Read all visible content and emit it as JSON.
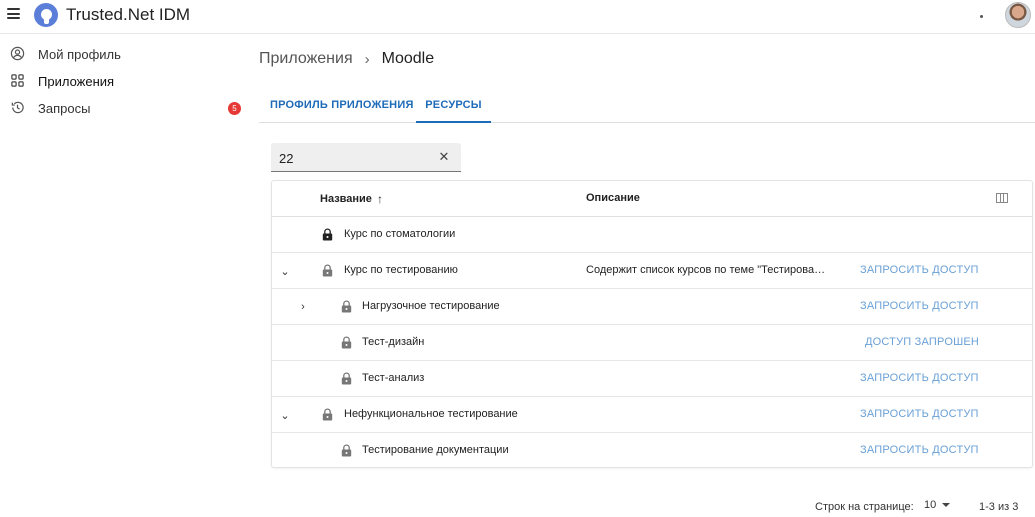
{
  "app": {
    "title": "Trusted.Net IDM"
  },
  "sidebar": {
    "items": [
      {
        "label": "Мой профиль",
        "icon": "account-circle-icon"
      },
      {
        "label": "Приложения",
        "icon": "apps-grid-icon"
      },
      {
        "label": "Запросы",
        "icon": "history-icon",
        "badge": "5"
      }
    ]
  },
  "breadcrumb": {
    "parent": "Приложения",
    "separator": "›",
    "current": "Moodle"
  },
  "tabs": [
    {
      "label": "ПРОФИЛЬ ПРИЛОЖЕНИЯ"
    },
    {
      "label": "РЕСУРСЫ"
    }
  ],
  "search": {
    "value": "22",
    "clear": "✕"
  },
  "table": {
    "headers": {
      "name": "Название",
      "sort": "↑",
      "description": "Описание"
    },
    "rows": [
      {
        "name": "Курс по стоматологии",
        "description": "",
        "action": ""
      },
      {
        "name": "Курс по тестированию",
        "description": "Содержит список курсов по теме \"Тестирование\"",
        "action": "ЗАПРОСИТЬ ДОСТУП"
      },
      {
        "name": "Нагрузочное тестирование",
        "description": "",
        "action": "ЗАПРОСИТЬ ДОСТУП"
      },
      {
        "name": "Тест-дизайн",
        "description": "",
        "action": "ДОСТУП ЗАПРОШЕН"
      },
      {
        "name": "Тест-анализ",
        "description": "",
        "action": "ЗАПРОСИТЬ ДОСТУП"
      },
      {
        "name": "Нефункциональное тестирование",
        "description": "",
        "action": "ЗАПРОСИТЬ ДОСТУП"
      },
      {
        "name": "Тестирование документации",
        "description": "",
        "action": "ЗАПРОСИТЬ ДОСТУП"
      }
    ]
  },
  "pagination": {
    "label": "Строк на странице:",
    "per_page": "10",
    "range": "1-3 из 3"
  },
  "colors": {
    "accent": "#1e6bb8",
    "action": "#6aa0d6",
    "badge": "#e53935",
    "logo": "#5b7fd8"
  }
}
